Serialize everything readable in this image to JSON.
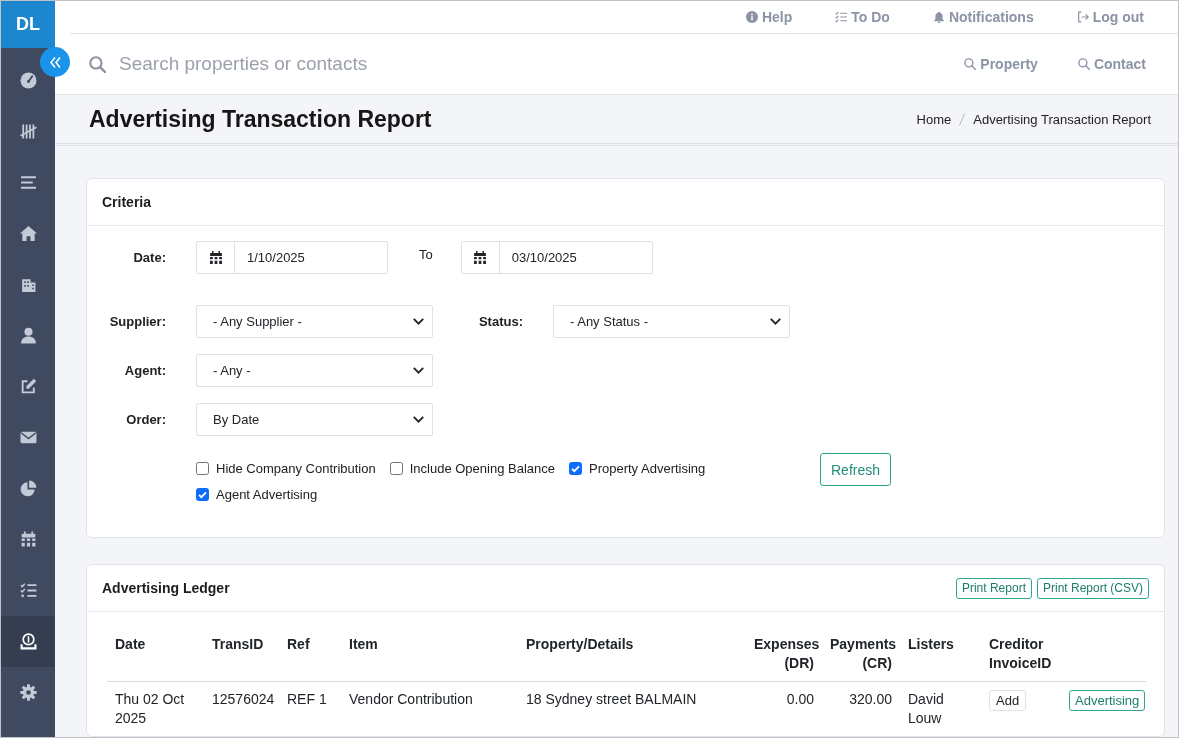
{
  "sidebar": {
    "logo": "DL",
    "items": [
      {
        "selected": false
      },
      {
        "selected": false
      },
      {
        "selected": false
      },
      {
        "selected": false
      },
      {
        "selected": false
      },
      {
        "selected": false
      },
      {
        "selected": false
      },
      {
        "selected": false
      },
      {
        "selected": false
      },
      {
        "selected": false
      },
      {
        "selected": false
      },
      {
        "selected": true
      },
      {
        "selected": false
      }
    ]
  },
  "top_links": [
    "Help",
    "To Do",
    "Notifications",
    "Log out"
  ],
  "search": {
    "placeholder": "Search properties or contacts",
    "scopes": [
      "Property",
      "Contact"
    ]
  },
  "page": {
    "title": "Advertising Transaction Report",
    "breadcrumb": [
      "Home",
      "Advertising Transaction Report"
    ]
  },
  "criteria": {
    "title": "Criteria",
    "date_label": "Date:",
    "date_from": "1/10/2025",
    "to_label": "To",
    "date_to": "03/10/2025",
    "filter_rows": [
      [
        {
          "label": "Supplier:",
          "value": "- Any Supplier -"
        },
        {
          "label": "Status:",
          "value": "- Any Status -"
        }
      ],
      [
        {
          "label": "Agent:",
          "value": "- Any -"
        }
      ],
      [
        {
          "label": "Order:",
          "value": "By Date"
        }
      ]
    ],
    "checkboxes": [
      {
        "label": "Hide Company Contribution",
        "checked": false
      },
      {
        "label": "Include Opening Balance",
        "checked": false
      },
      {
        "label": "Property Advertising",
        "checked": true
      },
      {
        "label": "Agent Advertising",
        "checked": true
      }
    ],
    "refresh": "Refresh"
  },
  "ledger": {
    "title": "Advertising Ledger",
    "actions": [
      "Print Report",
      "Print Report (CSV)"
    ],
    "columns": [
      {
        "label": "Date",
        "kind": "text"
      },
      {
        "label": "TransID",
        "kind": "text"
      },
      {
        "label": "Ref",
        "kind": "text"
      },
      {
        "label": "Item",
        "kind": "text"
      },
      {
        "label": "Property/Details",
        "kind": "text"
      },
      {
        "label": "Expenses (DR)",
        "kind": "amount"
      },
      {
        "label": "Payments (CR)",
        "kind": "amount"
      },
      {
        "label": "Listers",
        "kind": "text"
      },
      {
        "label": "Creditor InvoiceID",
        "kind": "text"
      }
    ],
    "rows": [
      {
        "cells": [
          "Thu 02 Oct 2025",
          "12576024",
          "REF 1",
          "Vendor Contribution",
          "18 Sydney street BALMAIN",
          "0.00",
          "320.00",
          "David Louw"
        ],
        "invoice_button": "Add",
        "category": "Advertising"
      }
    ]
  }
}
